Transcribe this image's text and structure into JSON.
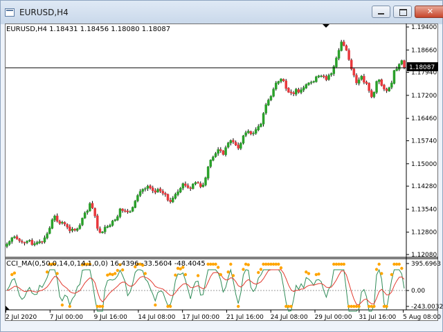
{
  "window": {
    "title": "EURUSD,H4"
  },
  "chart_header": {
    "symbol_tf": "EURUSD,H4",
    "values": "1.18431 1.18456 1.18080 1.18087",
    "text": "EURUSD,H4  1.18431 1.18456 1.18080 1.18087"
  },
  "price_axis": {
    "ticks": [
      "1.19400",
      "1.18660",
      "1.17940",
      "1.17200",
      "1.16460",
      "1.15740",
      "1.15000",
      "1.14280",
      "1.13540",
      "1.12800",
      "1.12080"
    ],
    "current_price": "1.18087"
  },
  "indicator": {
    "label": "CCI_MA(0,50,0,14,0,14,1,0,0) 16.4396 -33.5604 -48.4045",
    "axis_ticks": [
      "395.6963",
      "0.00",
      "-243.0032"
    ],
    "colors": {
      "dots": "#ffa500",
      "line_green": "#2e8b57",
      "line_red": "#e23a2f"
    }
  },
  "time_axis": {
    "labels": [
      "2 Jul 2020",
      "7 Jul 00:00",
      "9 Jul 16:00",
      "14 Jul 08:00",
      "17 Jul 00:00",
      "21 Jul 16:00",
      "24 Jul 08:00",
      "29 Jul 00:00",
      "31 Jul 16:00",
      "5 Aug 08:00"
    ]
  },
  "colors": {
    "bull": "#2aa02a",
    "bear": "#e8383d",
    "background": "#ffffff"
  },
  "chart_data": {
    "type": "candlestick",
    "y_range": [
      1.1208,
      1.194
    ],
    "close": [
      1.1242,
      1.125,
      1.1262,
      1.1265,
      1.1258,
      1.1252,
      1.1248,
      1.1245,
      1.1251,
      1.1254,
      1.124,
      1.1243,
      1.1247,
      1.125,
      1.1249,
      1.1262,
      1.1275,
      1.1293,
      1.132,
      1.1332,
      1.1315,
      1.1308,
      1.1312,
      1.1306,
      1.1296,
      1.1284,
      1.129,
      1.1286,
      1.1291,
      1.1302,
      1.1325,
      1.1342,
      1.1348,
      1.1372,
      1.1358,
      1.1332,
      1.1292,
      1.1279,
      1.1281,
      1.1296,
      1.1298,
      1.1302,
      1.1316,
      1.132,
      1.133,
      1.1355,
      1.1349,
      1.1347,
      1.1345,
      1.1346,
      1.136,
      1.138,
      1.1398,
      1.1411,
      1.1418,
      1.142,
      1.1428,
      1.1422,
      1.1413,
      1.1408,
      1.1418,
      1.1412,
      1.1405,
      1.1401,
      1.1383,
      1.1378,
      1.139,
      1.1402,
      1.141,
      1.1421,
      1.1436,
      1.143,
      1.1423,
      1.142,
      1.1435,
      1.144,
      1.1438,
      1.1426,
      1.1432,
      1.1455,
      1.149,
      1.1512,
      1.1522,
      1.1533,
      1.1546,
      1.1542,
      1.153,
      1.1552,
      1.1567,
      1.1575,
      1.157,
      1.156,
      1.155,
      1.1566,
      1.159,
      1.16,
      1.1605,
      1.1596,
      1.1598,
      1.161,
      1.162,
      1.1628,
      1.1662,
      1.169,
      1.1705,
      1.1717,
      1.174,
      1.176,
      1.1765,
      1.1773,
      1.1767,
      1.1742,
      1.173,
      1.1728,
      1.1725,
      1.174,
      1.173,
      1.1738,
      1.1745,
      1.1755,
      1.176,
      1.1762,
      1.1765,
      1.178,
      1.1783,
      1.1782,
      1.178,
      1.177,
      1.1785,
      1.179,
      1.1813,
      1.184,
      1.1865,
      1.1892,
      1.188,
      1.1865,
      1.1835,
      1.1805,
      1.1785,
      1.176,
      1.177,
      1.1782,
      1.1762,
      1.1758,
      1.1735,
      1.1715,
      1.173,
      1.1765,
      1.177,
      1.1752,
      1.174,
      1.1735,
      1.1745,
      1.176,
      1.18,
      1.1805,
      1.182,
      1.1832,
      1.1809
    ]
  }
}
